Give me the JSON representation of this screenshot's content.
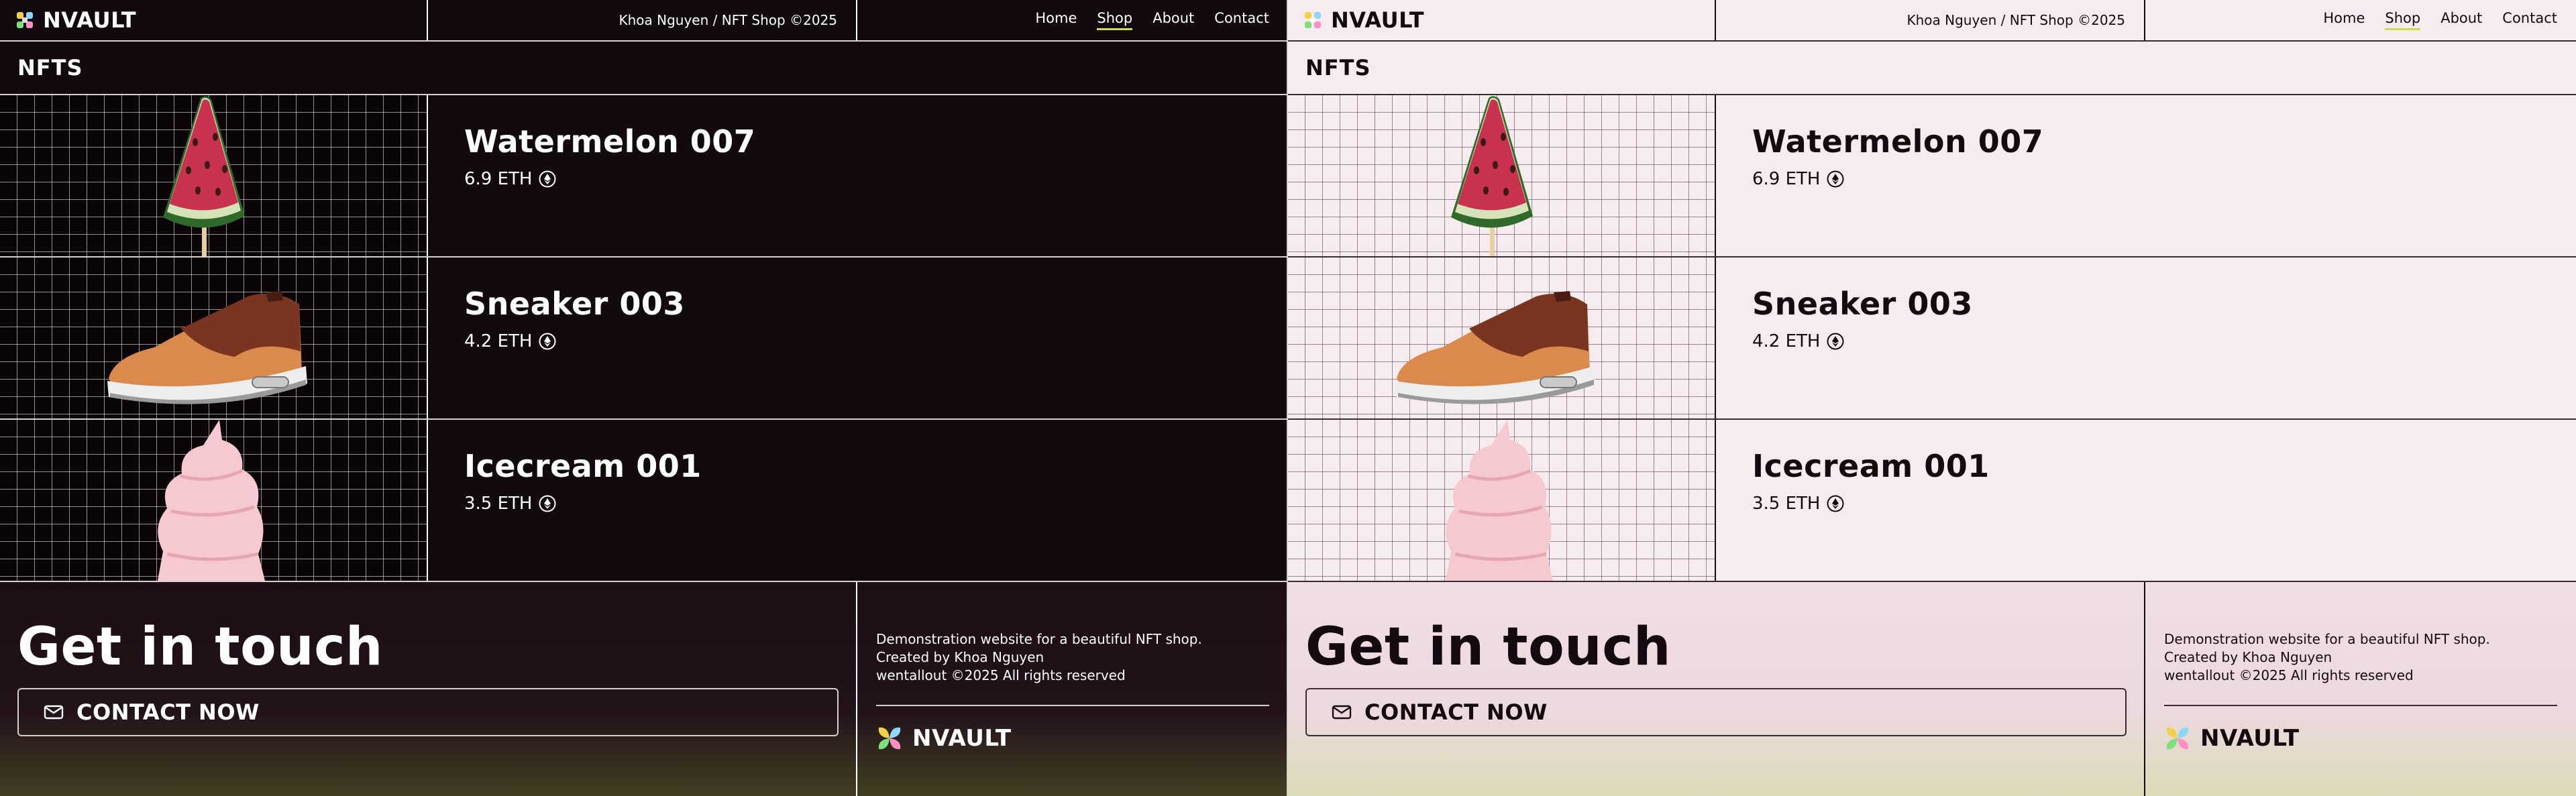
{
  "brand": "NVAULT",
  "header": {
    "credit": "Khoa Nguyen / NFT Shop ©2025",
    "nav": [
      "Home",
      "Shop",
      "About",
      "Contact"
    ],
    "active_nav": "Shop"
  },
  "section_title": "NFTS",
  "items": [
    {
      "name": "Watermelon 007",
      "price": "6.9 ETH",
      "image": "watermelon-popsicle-image"
    },
    {
      "name": "Sneaker 003",
      "price": "4.2 ETH",
      "image": "sneaker-image"
    },
    {
      "name": "Icecream 001",
      "price": "3.5 ETH",
      "image": "icecream-image"
    }
  ],
  "footer": {
    "heading": "Get in touch",
    "contact_label": "CONTACT NOW",
    "info": [
      "Demonstration website for a beautiful NFT shop.",
      "Created by Khoa Nguyen",
      "wentallout ©2025 All rights reserved"
    ]
  },
  "themes": [
    {
      "mode": "dark",
      "background": "#120a0e",
      "text": "#ffffff"
    },
    {
      "mode": "light",
      "background": "#f6ecf0",
      "text": "#140a10"
    }
  ],
  "colors": {
    "accent_underline": "#c6e04a"
  },
  "icons": [
    "logo-icon",
    "ethereum-icon",
    "mail-icon"
  ]
}
